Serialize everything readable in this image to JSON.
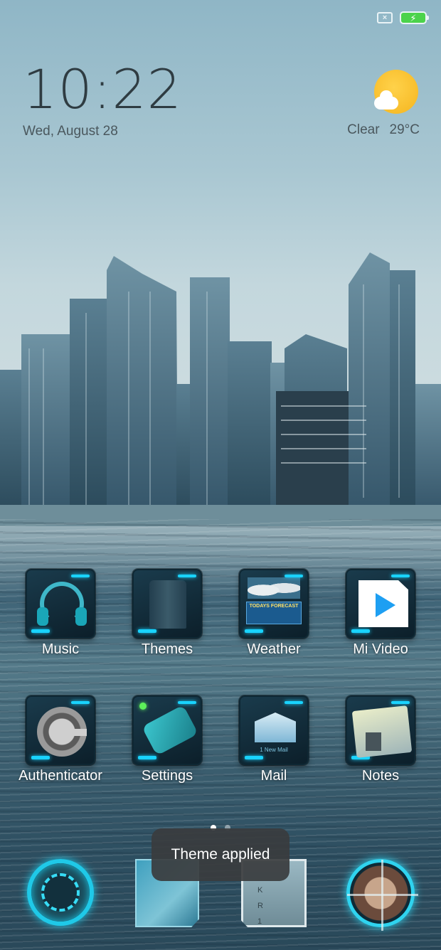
{
  "status_bar": {
    "sim_icon": "sim-error-icon",
    "battery_icon": "battery-charging-icon",
    "battery_color": "#4bd34b"
  },
  "clock": {
    "time": "10:22",
    "date": "Wed, August 28"
  },
  "weather": {
    "icon": "partly-sunny-icon",
    "condition": "Clear",
    "temperature": "29°C"
  },
  "apps": [
    {
      "label": "Music",
      "icon": "headphones-icon"
    },
    {
      "label": "Themes",
      "icon": "themes-icon"
    },
    {
      "label": "Weather",
      "icon": "weather-forecast-icon",
      "inner_text": "TODAYS FORECAST"
    },
    {
      "label": "Mi Video",
      "icon": "play-icon"
    },
    {
      "label": "Authenticator",
      "icon": "authenticator-icon"
    },
    {
      "label": "Settings",
      "icon": "gear-device-icon"
    },
    {
      "label": "Mail",
      "icon": "envelope-icon",
      "inner_text": "1 New Mail"
    },
    {
      "label": "Notes",
      "icon": "notes-icon"
    }
  ],
  "page_indicator": {
    "count": 2,
    "active": 0
  },
  "toast": {
    "message": "Theme applied"
  },
  "dock": [
    {
      "icon": "phone-dialer-ring-icon"
    },
    {
      "icon": "browser-map-icon"
    },
    {
      "icon": "keypad-icon"
    },
    {
      "icon": "camera-scope-icon"
    }
  ],
  "colors": {
    "accent": "#19d3ff",
    "clock_text": "#2f3c42",
    "toast_bg": "#3a3c3e"
  }
}
